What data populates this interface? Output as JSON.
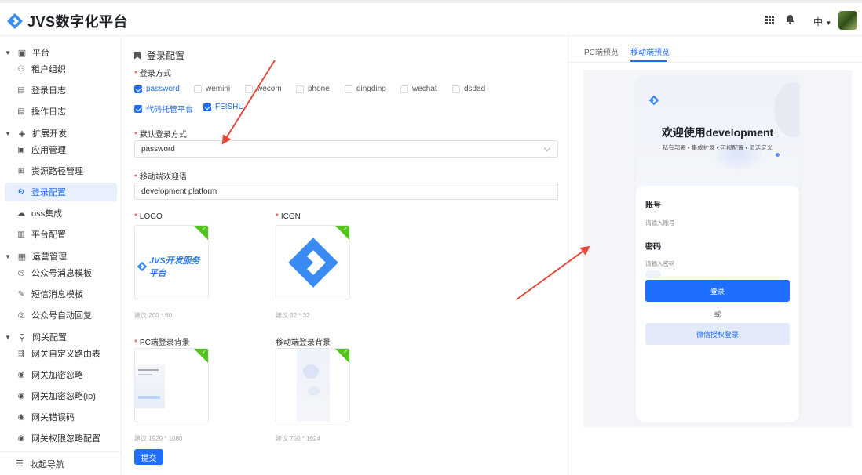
{
  "app": {
    "title": "JVS数字化平台",
    "lang": "中"
  },
  "sidebar": {
    "groups": [
      {
        "label": "平台",
        "items": [
          "租户组织",
          "登录日志",
          "操作日志"
        ]
      },
      {
        "label": "扩展开发",
        "items": [
          "应用管理",
          "资源路径管理",
          "登录配置",
          "oss集成",
          "平台配置"
        ]
      },
      {
        "label": "运营管理",
        "items": [
          "公众号消息模板",
          "短信消息模板",
          "公众号自动回复"
        ]
      },
      {
        "label": "网关配置",
        "items": [
          "网关自定义路由表",
          "网关加密忽略",
          "网关加密忽略(ip)",
          "网关错误码",
          "网关权限忽略配置"
        ]
      }
    ],
    "active_item": "登录配置",
    "collapse_label": "收起导航"
  },
  "form": {
    "section_title": "登录配置",
    "login_methods_label": "登录方式",
    "login_methods": [
      {
        "label": "password",
        "checked": true
      },
      {
        "label": "wemini",
        "checked": false
      },
      {
        "label": "wecom",
        "checked": false
      },
      {
        "label": "phone",
        "checked": false
      },
      {
        "label": "dingding",
        "checked": false
      },
      {
        "label": "wechat",
        "checked": false
      },
      {
        "label": "dsdad",
        "checked": false
      },
      {
        "label": "代码托管平台",
        "checked": true
      },
      {
        "label": "FEISHU",
        "checked": true
      }
    ],
    "default_method_label": "默认登录方式",
    "default_method_value": "password",
    "welcome_label": "移动端欢迎语",
    "welcome_value": "development platform",
    "logo_label": "LOGO",
    "logo_hint": "建议 200 * 60",
    "logo_text": "JVS开发服务平台",
    "icon_label": "ICON",
    "icon_hint": "建议 32 * 32",
    "pc_bg_label": "PC端登录背景",
    "pc_bg_hint": "建议 1920 * 1080",
    "mobile_bg_label": "移动端登录背景",
    "mobile_bg_hint": "建议 750 * 1624",
    "submit_label": "提交"
  },
  "preview": {
    "tabs": [
      "PC端预览",
      "移动端预览"
    ],
    "active_tab": "移动端预览",
    "title": "欢迎使用development",
    "subtitle": "私有部署 • 集成扩展 • 可视配置 • 灵活定义",
    "account_label": "账号",
    "account_placeholder": "请输入账号",
    "password_label": "密码",
    "password_placeholder": "请输入密码",
    "login_button": "登录",
    "or_text": "或",
    "wechat_button": "微信授权登录"
  },
  "colors": {
    "primary": "#1e6fff",
    "success": "#52c41a",
    "annotation": "#e84a3c"
  }
}
